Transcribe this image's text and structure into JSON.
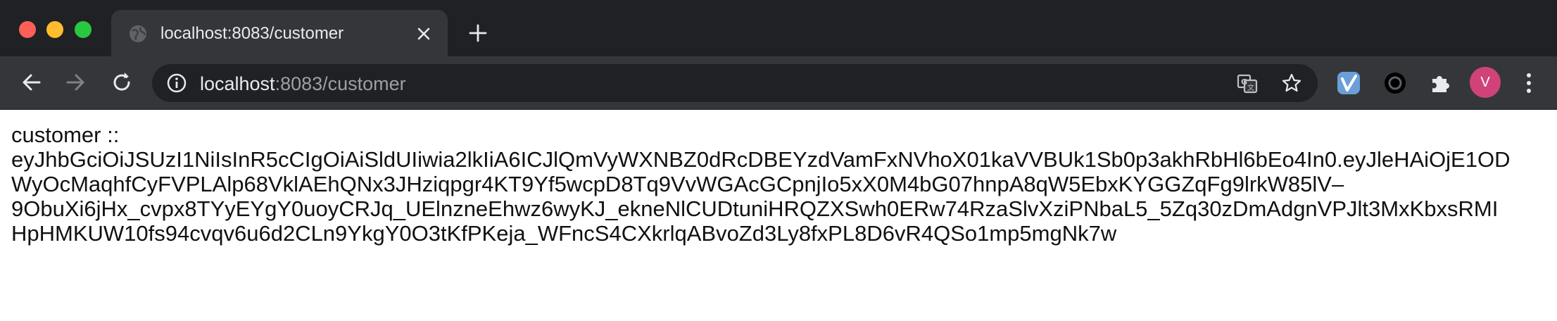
{
  "browser": {
    "tab": {
      "title": "localhost:8083/customer"
    },
    "address_bar": {
      "host": "localhost",
      "rest": ":8083/customer"
    },
    "profile": {
      "initial": "V",
      "color": "#d0437a"
    }
  },
  "page": {
    "lines": [
      "customer ::",
      "eyJhbGciOiJSUzI1NiIsInR5cCIgOiAiSldUIiwia2lkIiA6ICJlQmVyWXNBZ0dRcDBEYzdVamFxNVhoX01kaVVBUk1Sb0p3akhRbHl6bEo4In0.eyJleHAiOjE1OD",
      "WyOcMaqhfCyFVPLAlp68VklAEhQNx3JHziqpgr4KT9Yf5wcpD8Tq9VvWGAcGCpnjIo5xX0M4bG07hnpA8qW5EbxKYGGZqFg9lrkW85lV–",
      "9ObuXi6jHx_cvpx8TYyEYgY0uoyCRJq_UElnzneEhwz6wyKJ_ekneNlCUDtuniHRQZXSwh0ERw74RzaSlvXziPNbaL5_5Zq30zDmAdgnVPJlt3MxKbxsRMI",
      "HpHMKUW10fs94cvqv6u6d2CLn9YkgY0O3tKfPKeja_WFncS4CXkrlqABvoZd3Ly8fxPL8D6vR4QSo1mp5mgNk7w"
    ]
  }
}
